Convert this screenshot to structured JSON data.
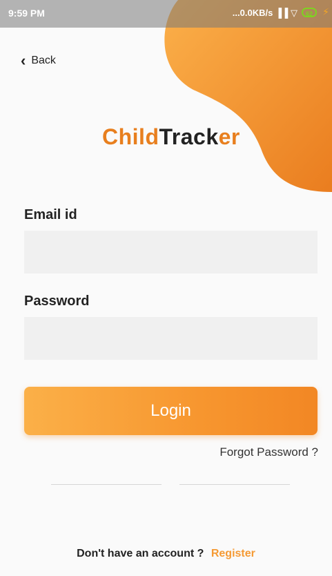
{
  "status": {
    "time": "9:59 PM",
    "network": "...0.0KB/s",
    "battery": "62"
  },
  "nav": {
    "back_label": "Back"
  },
  "brand": {
    "part1": "Child",
    "part2": "Track",
    "part3": "er"
  },
  "form": {
    "email_label": "Email id",
    "email_value": "",
    "password_label": "Password",
    "password_value": "",
    "login_label": "Login",
    "forgot_label": "Forgot Password ?"
  },
  "footer": {
    "prompt": "Don't have an account ?",
    "register_label": "Register"
  },
  "colors": {
    "accent": "#f7962f",
    "brand_orange": "#e87f1e"
  }
}
